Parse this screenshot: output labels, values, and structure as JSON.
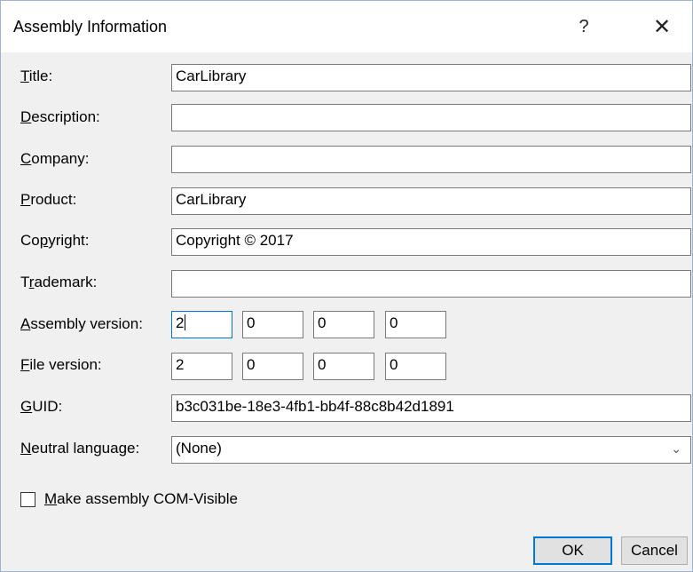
{
  "window": {
    "title": "Assembly Information",
    "help_glyph": "?",
    "close_glyph": "✕"
  },
  "fields": {
    "title": {
      "label_key": "T",
      "label_rest": "itle:",
      "value": "CarLibrary"
    },
    "description": {
      "label_key": "D",
      "label_rest": "escription:",
      "value": ""
    },
    "company": {
      "label_key": "C",
      "label_rest": "ompany:",
      "value": ""
    },
    "product": {
      "label_key": "P",
      "label_rest": "roduct:",
      "value": "CarLibrary"
    },
    "copyright": {
      "label_pre": "Co",
      "label_key": "p",
      "label_rest": "yright:",
      "value": "Copyright ©  2017"
    },
    "trademark": {
      "label_pre": "T",
      "label_key": "r",
      "label_rest": "ademark:",
      "value": ""
    },
    "assembly_version": {
      "label_key": "A",
      "label_rest": "ssembly version:",
      "values": [
        "2",
        "0",
        "0",
        "0"
      ]
    },
    "file_version": {
      "label_key": "F",
      "label_rest": "ile version:",
      "values": [
        "2",
        "0",
        "0",
        "0"
      ]
    },
    "guid": {
      "label_key": "G",
      "label_rest": "UID:",
      "value": "b3c031be-18e3-4fb1-bb4f-88c8b42d1891"
    },
    "neutral_language": {
      "label_key": "N",
      "label_rest": "eutral language:",
      "value": "(None)"
    }
  },
  "com_visible": {
    "label_key": "M",
    "label_rest": "ake assembly COM-Visible",
    "checked": false
  },
  "buttons": {
    "ok": "OK",
    "cancel": "Cancel"
  },
  "colors": {
    "accent": "#0078d7",
    "dialog_bg": "#f0f0f0",
    "border": "#7a7a7a"
  }
}
